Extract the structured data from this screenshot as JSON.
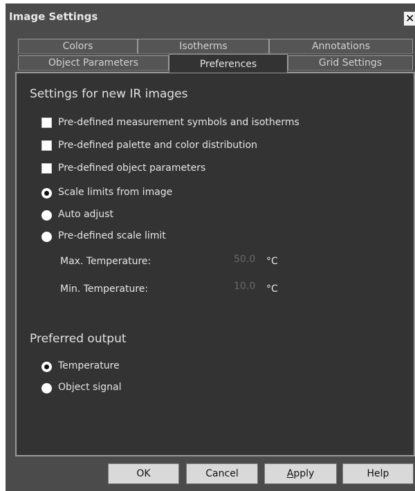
{
  "window": {
    "title": "Image Settings",
    "close_label": "✕"
  },
  "tabs": {
    "row1": [
      "Colors",
      "Isotherms",
      "Annotations"
    ],
    "row2": [
      "Object Parameters",
      "Preferences",
      "Grid Settings"
    ],
    "active": "Preferences"
  },
  "settings": {
    "section_title": "Settings for new IR images",
    "checkboxes": [
      {
        "label": "Pre-defined measurement symbols and isotherms",
        "checked": false
      },
      {
        "label": "Pre-defined palette and color distribution",
        "checked": false
      },
      {
        "label": "Pre-defined object parameters",
        "checked": false
      }
    ],
    "scale_radios": [
      {
        "label": "Scale limits from image",
        "selected": true
      },
      {
        "label": "Auto adjust",
        "selected": false
      },
      {
        "label": "Pre-defined scale limit",
        "selected": false
      }
    ],
    "max_temp": {
      "label": "Max. Temperature:",
      "value": "50.0",
      "unit": "°C"
    },
    "min_temp": {
      "label": "Min. Temperature:",
      "value": "10.0",
      "unit": "°C"
    }
  },
  "output": {
    "section_title": "Preferred output",
    "radios": [
      {
        "label": "Temperature",
        "selected": true
      },
      {
        "label": "Object signal",
        "selected": false
      }
    ]
  },
  "buttons": {
    "ok": "OK",
    "cancel": "Cancel",
    "apply": "Apply",
    "help": "Help"
  },
  "colors": {
    "window_bg": "#4b4b4b",
    "panel_bg": "#333333",
    "text": "#e6e6e6",
    "disabled_text": "#6a6a6a",
    "button_bg": "#d9d9d9"
  }
}
